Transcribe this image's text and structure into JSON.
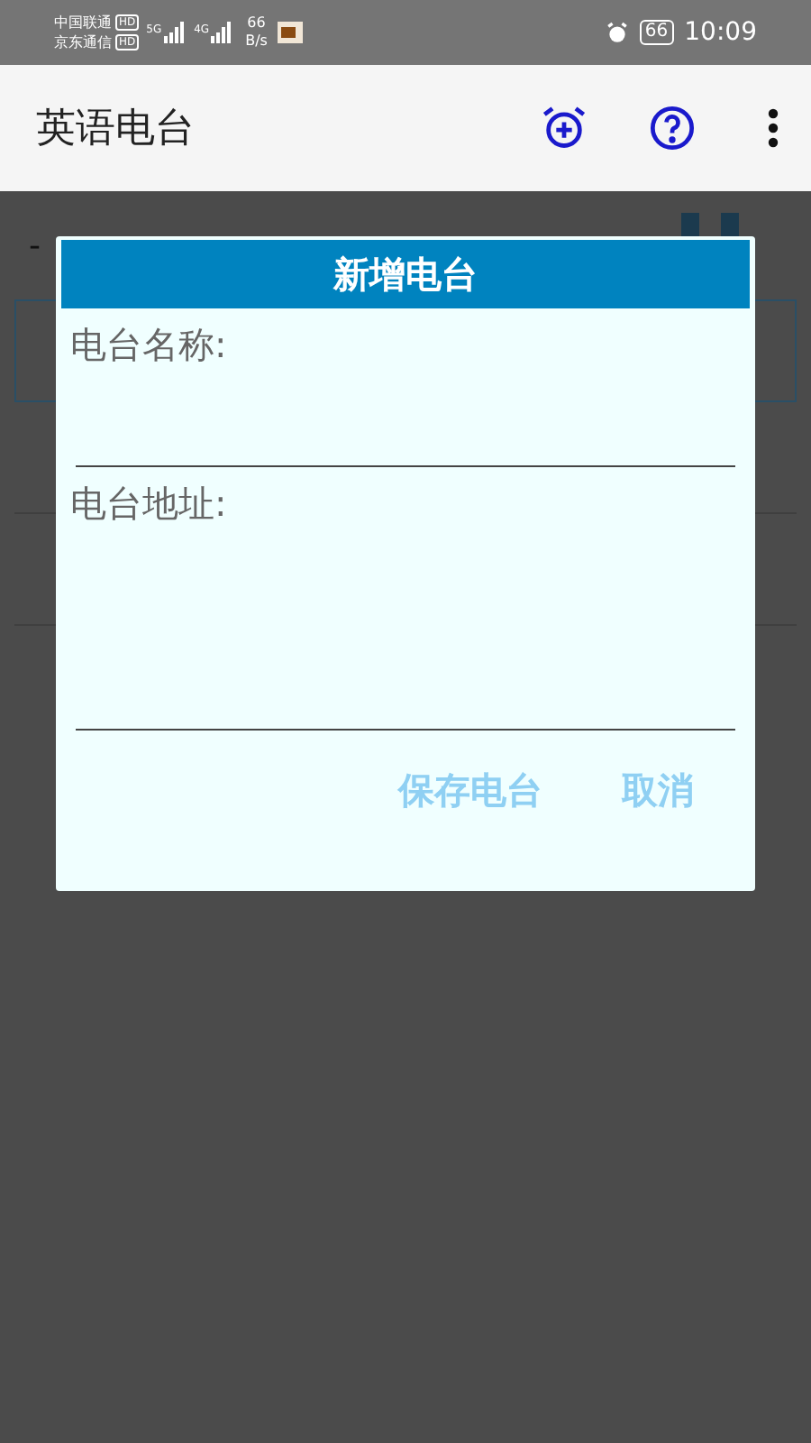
{
  "status_bar": {
    "carriers": [
      "中国联通",
      "京东通信"
    ],
    "hd": [
      "HD",
      "HD"
    ],
    "network": [
      "5G",
      "4G"
    ],
    "speed": [
      "66",
      "B/s"
    ],
    "battery": "66",
    "time": "10:09"
  },
  "app_bar": {
    "title": "英语电台"
  },
  "background": {
    "row_text": "-"
  },
  "dialog": {
    "title": "新增电台",
    "fields": [
      {
        "label": "电台名称:"
      },
      {
        "label": "电台地址:"
      }
    ],
    "buttons": [
      "保存电台",
      "取消"
    ]
  }
}
